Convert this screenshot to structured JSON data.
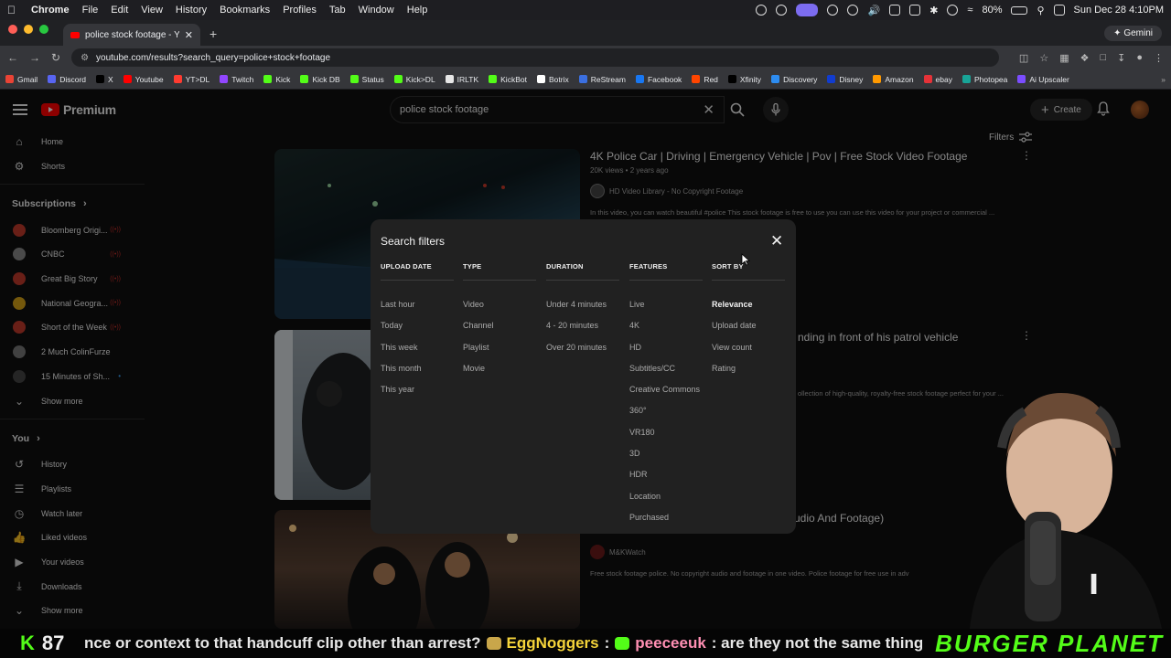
{
  "menubar": {
    "app": "Chrome",
    "items": [
      "File",
      "Edit",
      "View",
      "History",
      "Bookmarks",
      "Profiles",
      "Tab",
      "Window",
      "Help"
    ],
    "battery": "80%",
    "datetime": "Sun Dec 28  4:10PM"
  },
  "browser": {
    "tab_title": "police stock footage - YouTube",
    "gemini_label": "Gemini",
    "url": "youtube.com/results?search_query=police+stock+footage",
    "bookmarks": [
      {
        "label": "Gmail",
        "color": "#ea4335"
      },
      {
        "label": "Discord",
        "color": "#5865f2"
      },
      {
        "label": "X",
        "color": "#000000"
      },
      {
        "label": "Youtube",
        "color": "#ff0000"
      },
      {
        "label": "YT>DL",
        "color": "#ff3b30"
      },
      {
        "label": "Twitch",
        "color": "#9146ff"
      },
      {
        "label": "Kick",
        "color": "#53fc18"
      },
      {
        "label": "Kick DB",
        "color": "#53fc18"
      },
      {
        "label": "Status",
        "color": "#53fc18"
      },
      {
        "label": "Kick>DL",
        "color": "#53fc18"
      },
      {
        "label": "IRLTK",
        "color": "#e6e6e6"
      },
      {
        "label": "KickBot",
        "color": "#53fc18"
      },
      {
        "label": "Botrix",
        "color": "#ffffff"
      },
      {
        "label": "ReStream",
        "color": "#3b6fe0"
      },
      {
        "label": "Facebook",
        "color": "#1877f2"
      },
      {
        "label": "Red",
        "color": "#ff4500"
      },
      {
        "label": "Xfinity",
        "color": "#000000"
      },
      {
        "label": "Discovery",
        "color": "#2d8cf0"
      },
      {
        "label": "Disney",
        "color": "#113ccf"
      },
      {
        "label": "Amazon",
        "color": "#ff9900"
      },
      {
        "label": "ebay",
        "color": "#e53238"
      },
      {
        "label": "Photopea",
        "color": "#18a497"
      },
      {
        "label": "Ai Upscaler",
        "color": "#7b4dff"
      }
    ]
  },
  "youtube": {
    "logo_text": "Premium",
    "search_value": "police stock footage",
    "create_label": "Create",
    "filters_label": "Filters"
  },
  "sidebar": {
    "main": [
      {
        "label": "Home",
        "icon": "home-icon"
      },
      {
        "label": "Shorts",
        "icon": "shorts-icon"
      }
    ],
    "subscriptions_title": "Subscriptions",
    "subscriptions": [
      {
        "label": "Bloomberg Origi...",
        "color": "#c0392b",
        "status": "live"
      },
      {
        "label": "CNBC",
        "color": "#888888",
        "status": "live"
      },
      {
        "label": "Great Big Story",
        "color": "#c0392b",
        "status": "live"
      },
      {
        "label": "National Geogra...",
        "color": "#d4a017",
        "status": "live"
      },
      {
        "label": "Short of the Week",
        "color": "#c0392b",
        "status": "live"
      },
      {
        "label": "2 Much ColinFurze",
        "color": "#777777",
        "status": ""
      },
      {
        "label": "15 Minutes of Sh...",
        "color": "#444444",
        "status": "new"
      }
    ],
    "show_more_label": "Show more",
    "you_title": "You",
    "you_items": [
      {
        "label": "History",
        "icon": "history-icon"
      },
      {
        "label": "Playlists",
        "icon": "playlists-icon"
      },
      {
        "label": "Watch later",
        "icon": "watch-later-icon"
      },
      {
        "label": "Liked videos",
        "icon": "liked-icon"
      },
      {
        "label": "Your videos",
        "icon": "your-videos-icon"
      },
      {
        "label": "Downloads",
        "icon": "downloads-icon"
      }
    ],
    "show_more_label_2": "Show more"
  },
  "results": [
    {
      "title": "4K Police Car | Driving | Emergency Vehicle | Pov | Free Stock Video Footage",
      "meta": "20K views • 2 years ago",
      "channel": "HD Video Library - No Copyright Footage",
      "description": "In this video, you can watch beautiful #police This stock footage is free to use you can use this video for your project or commercial ..."
    },
    {
      "title_visible": "nding in front of his patrol vehicle",
      "description_visible": "ollection of high-quality, royalty-free stock footage perfect for your ..."
    },
    {
      "title_visible": "udio And Footage)",
      "channel": "M&KWatch",
      "description": "Free stock footage police. No copyright audio and footage in one video. Police footage for free use in adv"
    }
  ],
  "filters_dialog": {
    "title": "Search filters",
    "columns": [
      {
        "heading": "UPLOAD DATE",
        "options": [
          "Last hour",
          "Today",
          "This week",
          "This month",
          "This year"
        ]
      },
      {
        "heading": "TYPE",
        "options": [
          "Video",
          "Channel",
          "Playlist",
          "Movie"
        ]
      },
      {
        "heading": "DURATION",
        "options": [
          "Under 4 minutes",
          "4 - 20 minutes",
          "Over 20 minutes"
        ]
      },
      {
        "heading": "FEATURES",
        "options": [
          "Live",
          "4K",
          "HD",
          "Subtitles/CC",
          "Creative Commons",
          "360°",
          "VR180",
          "3D",
          "HDR",
          "Location",
          "Purchased"
        ]
      },
      {
        "heading": "SORT BY",
        "options": [
          "Relevance",
          "Upload date",
          "View count",
          "Rating"
        ],
        "selected": "Relevance"
      }
    ]
  },
  "stream_bar": {
    "viewer_count": "87",
    "chat_fragment": "nce or context to that handcuff clip other than arrest?",
    "user1": "EggNoggers",
    "user2": "peeceeuk",
    "message2": ": are they not the same thing?",
    "sep": ":",
    "brand": "BURGER PLANET"
  }
}
